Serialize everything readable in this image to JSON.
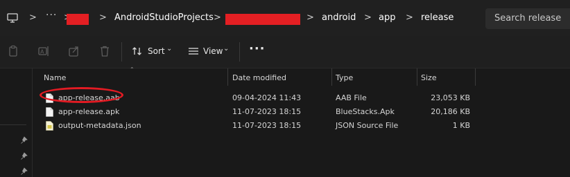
{
  "address_bar": {
    "overflow_label": "···",
    "breadcrumbs": [
      "AndroidStudioProjects",
      "android",
      "app",
      "release"
    ],
    "search_placeholder": "Search release"
  },
  "command_bar": {
    "sort_label": "Sort",
    "view_label": "View",
    "more_label": "···"
  },
  "file_list": {
    "columns": [
      "Name",
      "Date modified",
      "Type",
      "Size"
    ],
    "rows": [
      {
        "name": "app-release.aab",
        "date": "09-04-2024 11:43",
        "type": "AAB File",
        "size": "23,053 KB"
      },
      {
        "name": "app-release.apk",
        "date": "11-07-2023 18:15",
        "type": "BlueStacks.Apk",
        "size": "20,186 KB"
      },
      {
        "name": "output-metadata.json",
        "date": "11-07-2023 18:15",
        "type": "JSON Source File",
        "size": "1 KB"
      }
    ]
  },
  "colors": {
    "annotation_red": "#e31b23",
    "background": "#191919",
    "toolbar": "#202020"
  },
  "icons": [
    "monitor-icon",
    "chevron-right-icon",
    "copy-icon",
    "rename-icon",
    "share-icon",
    "delete-icon",
    "sort-icon",
    "view-icon",
    "pin-icon",
    "file-icon",
    "json-file-icon"
  ]
}
